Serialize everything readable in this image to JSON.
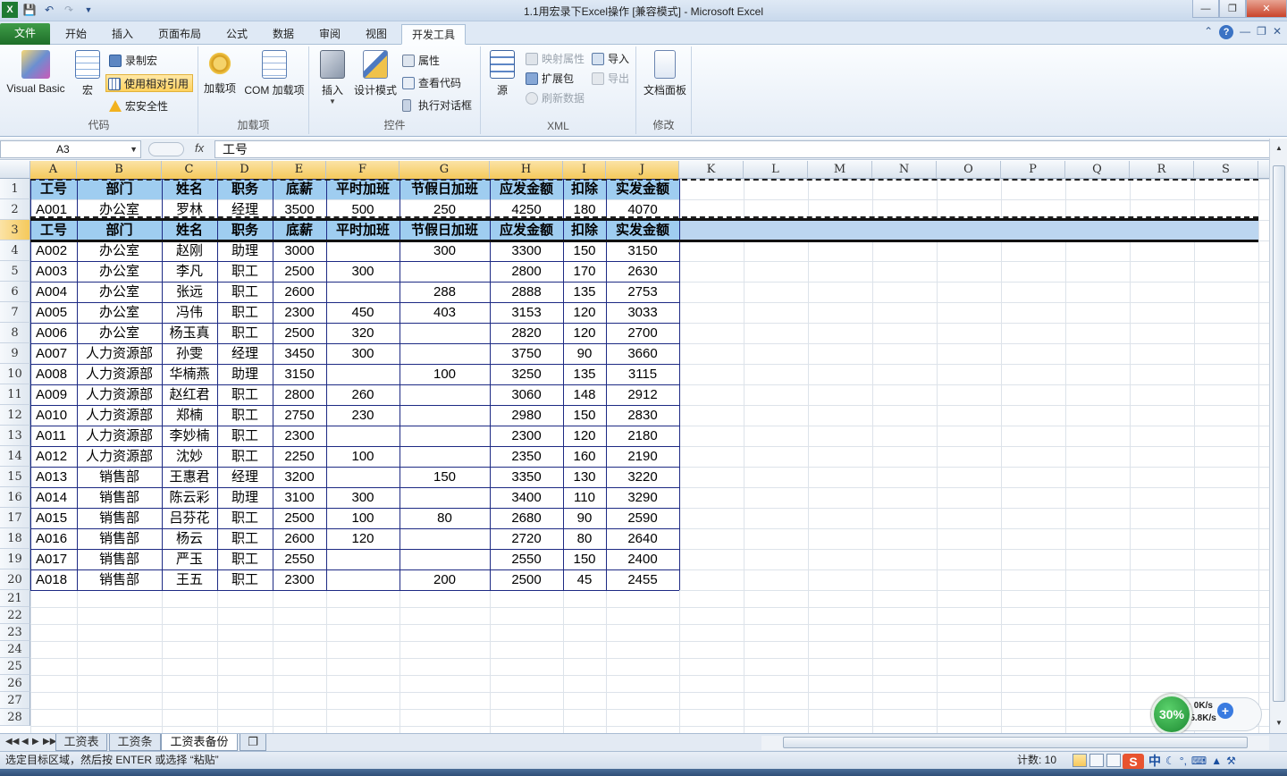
{
  "window": {
    "title": "1.1用宏录下Excel操作  [兼容模式]  -  Microsoft Excel"
  },
  "ribbon_tabs": [
    "文件",
    "开始",
    "插入",
    "页面布局",
    "公式",
    "数据",
    "审阅",
    "视图",
    "开发工具"
  ],
  "active_tab": "开发工具",
  "ribbon": {
    "code": {
      "label": "代码",
      "visual_basic": "Visual Basic",
      "macros": "宏",
      "record_macro": "录制宏",
      "relative_ref": "使用相对引用",
      "macro_security": "宏安全性"
    },
    "addins": {
      "label": "加载项",
      "addins": "加载项",
      "com_addins": "COM 加载项"
    },
    "controls": {
      "label": "控件",
      "insert": "插入",
      "design_mode": "设计模式",
      "properties": "属性",
      "view_code": "查看代码",
      "run_dialog": "执行对话框"
    },
    "xml": {
      "label": "XML",
      "source": "源",
      "map_props": "映射属性",
      "expansion": "扩展包",
      "refresh": "刷新数据",
      "import": "导入",
      "export": "导出"
    },
    "modify": {
      "label": "修改",
      "doc_panel": "文档面板"
    }
  },
  "formula_bar": {
    "name_box": "A3",
    "fx": "fx",
    "value": "工号"
  },
  "columns": [
    "A",
    "B",
    "C",
    "D",
    "E",
    "F",
    "G",
    "H",
    "I",
    "J",
    "K",
    "L",
    "M",
    "N",
    "O",
    "P",
    "Q",
    "R",
    "S"
  ],
  "rows": [
    "1",
    "2",
    "3",
    "4",
    "5",
    "6",
    "7",
    "8",
    "9",
    "10",
    "11",
    "12",
    "13",
    "14",
    "15",
    "16",
    "17",
    "18",
    "19",
    "20",
    "21",
    "22",
    "23",
    "24",
    "25",
    "26",
    "27",
    "28"
  ],
  "table": {
    "header": [
      "工号",
      "部门",
      "姓名",
      "职务",
      "底薪",
      "平时加班",
      "节假日加班",
      "应发金额",
      "扣除",
      "实发金额"
    ],
    "row2": [
      "A001",
      "办公室",
      "罗林",
      "经理",
      "3500",
      "500",
      "250",
      "4250",
      "180",
      "4070"
    ],
    "data": [
      [
        "A002",
        "办公室",
        "赵刚",
        "助理",
        "3000",
        "",
        "300",
        "3300",
        "150",
        "3150"
      ],
      [
        "A003",
        "办公室",
        "李凡",
        "职工",
        "2500",
        "300",
        "",
        "2800",
        "170",
        "2630"
      ],
      [
        "A004",
        "办公室",
        "张远",
        "职工",
        "2600",
        "",
        "288",
        "2888",
        "135",
        "2753"
      ],
      [
        "A005",
        "办公室",
        "冯伟",
        "职工",
        "2300",
        "450",
        "403",
        "3153",
        "120",
        "3033"
      ],
      [
        "A006",
        "办公室",
        "杨玉真",
        "职工",
        "2500",
        "320",
        "",
        "2820",
        "120",
        "2700"
      ],
      [
        "A007",
        "人力资源部",
        "孙雯",
        "经理",
        "3450",
        "300",
        "",
        "3750",
        "90",
        "3660"
      ],
      [
        "A008",
        "人力资源部",
        "华楠燕",
        "助理",
        "3150",
        "",
        "100",
        "3250",
        "135",
        "3115"
      ],
      [
        "A009",
        "人力资源部",
        "赵红君",
        "职工",
        "2800",
        "260",
        "",
        "3060",
        "148",
        "2912"
      ],
      [
        "A010",
        "人力资源部",
        "郑楠",
        "职工",
        "2750",
        "230",
        "",
        "2980",
        "150",
        "2830"
      ],
      [
        "A011",
        "人力资源部",
        "李妙楠",
        "职工",
        "2300",
        "",
        "",
        "2300",
        "120",
        "2180"
      ],
      [
        "A012",
        "人力资源部",
        "沈妙",
        "职工",
        "2250",
        "100",
        "",
        "2350",
        "160",
        "2190"
      ],
      [
        "A013",
        "销售部",
        "王惠君",
        "经理",
        "3200",
        "",
        "150",
        "3350",
        "130",
        "3220"
      ],
      [
        "A014",
        "销售部",
        "陈云彩",
        "助理",
        "3100",
        "300",
        "",
        "3400",
        "110",
        "3290"
      ],
      [
        "A015",
        "销售部",
        "吕芬花",
        "职工",
        "2500",
        "100",
        "80",
        "2680",
        "90",
        "2590"
      ],
      [
        "A016",
        "销售部",
        "杨云",
        "职工",
        "2600",
        "120",
        "",
        "2720",
        "80",
        "2640"
      ],
      [
        "A017",
        "销售部",
        "严玉",
        "职工",
        "2550",
        "",
        "",
        "2550",
        "150",
        "2400"
      ],
      [
        "A018",
        "销售部",
        "王五",
        "职工",
        "2300",
        "",
        "200",
        "2500",
        "45",
        "2455"
      ]
    ]
  },
  "sheets": [
    "工资表",
    "工资条",
    "工资表备份"
  ],
  "active_sheet": "工资表备份",
  "status": {
    "message": "选定目标区域，然后按 ENTER 或选择 “粘贴”",
    "count": "计数: 10"
  },
  "ime": {
    "logo": "S",
    "lang": "中"
  },
  "network": {
    "percent": "30%",
    "up": "0K/s",
    "down": "15.8K/s",
    "plus": "+"
  },
  "colors": {
    "header_fill": "#9fcdf0",
    "table_border": "#1d2a84",
    "file_tab": "#2a8434",
    "selection": "#bcd6f0"
  }
}
